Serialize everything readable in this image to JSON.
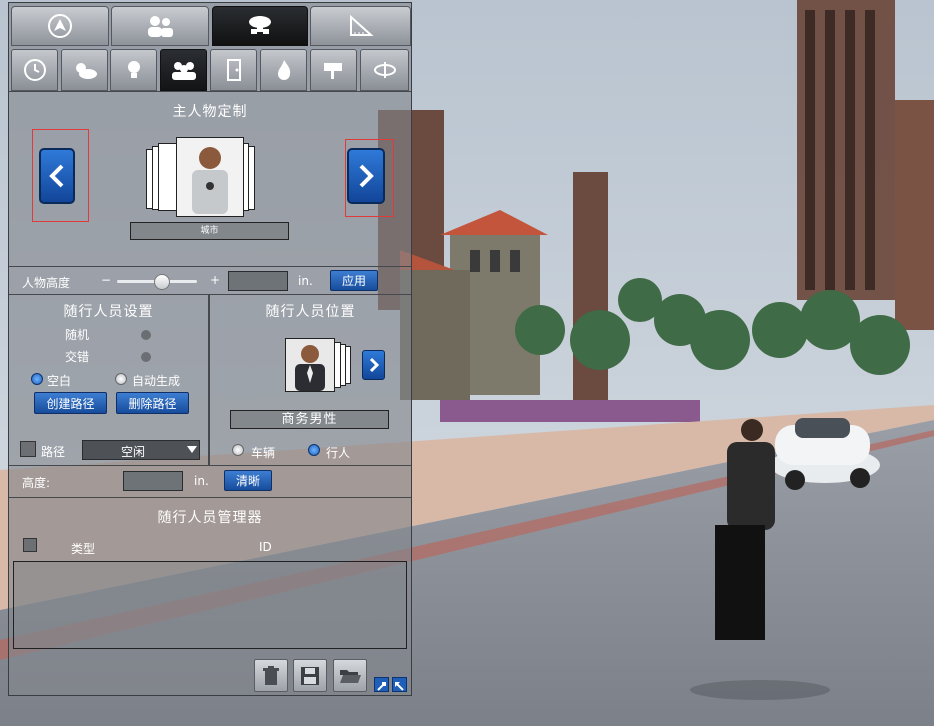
{
  "main_tabs": [
    {
      "icon": "navigation-icon",
      "active": false
    },
    {
      "icon": "people-settings-icon",
      "active": false
    },
    {
      "icon": "cloud-network-icon",
      "active": true
    },
    {
      "icon": "ruler-triangle-icon",
      "active": false
    }
  ],
  "sub_tabs": [
    {
      "icon": "clock-icon"
    },
    {
      "icon": "weather-icon"
    },
    {
      "icon": "light-bulb-icon"
    },
    {
      "icon": "people-group-icon"
    },
    {
      "icon": "door-icon"
    },
    {
      "icon": "fire-icon"
    },
    {
      "icon": "security-camera-icon"
    },
    {
      "icon": "rotate-icon"
    }
  ],
  "main_character": {
    "title": "主人物定制",
    "name": "城市"
  },
  "height_row": {
    "label": "人物高度",
    "minus": "−",
    "plus": "+",
    "value": "",
    "unit": "in.",
    "apply": "应用",
    "slider_level": 0.55
  },
  "follower_settings": {
    "title": "随行人员设置",
    "random_label": "随机",
    "stagger_label": "交错",
    "radio_blank": "空白",
    "radio_auto": "自动生成",
    "create_path": "创建路径",
    "delete_path": "删除路径",
    "path_label": "路径",
    "path_value": "空闲"
  },
  "follower_position": {
    "title": "随行人员位置",
    "name": "商务男性",
    "radio_vehicle": "车辆",
    "radio_pedestrian": "行人"
  },
  "altitude_row": {
    "label": "高度:",
    "value": "",
    "unit": "in.",
    "clear": "清晰"
  },
  "manager": {
    "title": "随行人员管理器",
    "col_type": "类型",
    "col_id": "ID"
  },
  "toolbar": [
    {
      "icon": "trash-icon"
    },
    {
      "icon": "save-icon"
    },
    {
      "icon": "folder-open-icon"
    }
  ],
  "colors": {
    "accent_blue": "#1f5fb8",
    "panel_bg": "#83878c",
    "highlight_red": "#e03a3a"
  }
}
